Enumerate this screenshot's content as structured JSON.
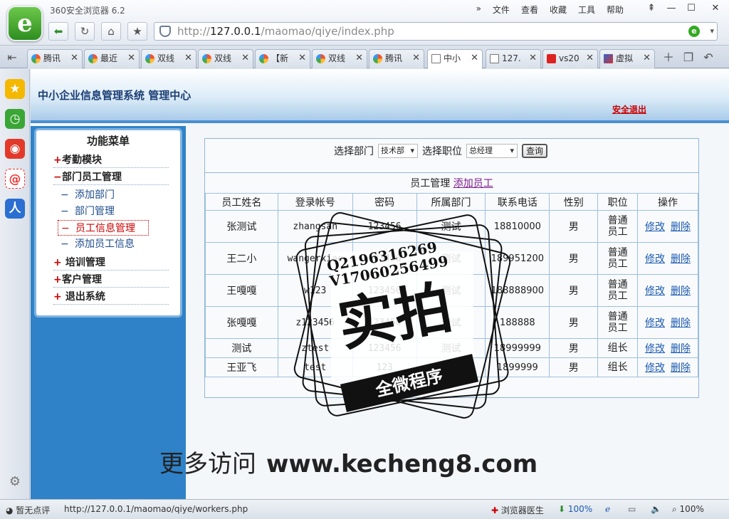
{
  "browser": {
    "app_title": "360安全浏览器 6.2",
    "menu": [
      "»",
      "文件",
      "查看",
      "收藏",
      "工具",
      "帮助"
    ],
    "url_host": "127.0.0.1",
    "url_path": "/maomao/qiye/index.php",
    "url_scheme": "http://",
    "tabs": [
      "腾讯",
      "最近",
      "双线",
      "双线",
      "【新",
      "双线",
      "腾讯",
      "中小",
      "127.",
      "vs20",
      "虚拟"
    ]
  },
  "page": {
    "system_title": "中小企业信息管理系统  管理中心",
    "logout": "安全退出",
    "menu_title": "功能菜单",
    "menu": {
      "attendance": "考勤模块",
      "dept_staff": "部门员工管理",
      "add_dept": "添加部门",
      "dept_manage": "部门管理",
      "staff_manage": "员工信息管理",
      "add_staff": "添加员工信息",
      "training": "培训管理",
      "customer": "客户管理",
      "exit": "退出系统"
    },
    "filter": {
      "dept_label": "选择部门",
      "dept_value": "技术部",
      "position_label": "选择职位",
      "position_value": "总经理",
      "query_button": "查询"
    },
    "section": {
      "title": "员工管理",
      "add_link": "添加员工"
    },
    "table": {
      "headers": [
        "员工姓名",
        "登录帐号",
        "密码",
        "所属部门",
        "联系电话",
        "性别",
        "职位",
        "操作"
      ],
      "edit": "修改",
      "delete": "删除",
      "rows": [
        [
          "张测试",
          "zhangsan",
          "123456",
          "测试",
          "18810000",
          "男",
          "普通员工"
        ],
        [
          "王二小",
          "wangerxiao",
          "123456",
          "测试",
          "189951200",
          "男",
          "普通员工"
        ],
        [
          "王嘎嘎",
          "w123",
          "123456",
          "测试",
          "188888900",
          "男",
          "普通员工"
        ],
        [
          "张嘎嘎",
          "z123456",
          "123456",
          "测试",
          "188888",
          "男",
          "普通员工"
        ],
        [
          "测试",
          "ztest",
          "123456",
          "测试",
          "18999999",
          "男",
          "组长"
        ],
        [
          "王亚飞",
          "test",
          "123",
          "测试",
          "1899999",
          "男",
          "组长"
        ]
      ]
    }
  },
  "watermark": {
    "qq": "Q2196316269",
    "vx": "V17060256499",
    "main": "实拍",
    "ribbon": "全微程序",
    "site_prefix": "更多访问",
    "site": "www.kecheng8.com"
  },
  "statusbar": {
    "review": "暂无点评",
    "link": "http://127.0.0.1/maomao/qiye/workers.php",
    "doctor": "浏览器医生",
    "download": "100%",
    "zoom": "100%"
  }
}
